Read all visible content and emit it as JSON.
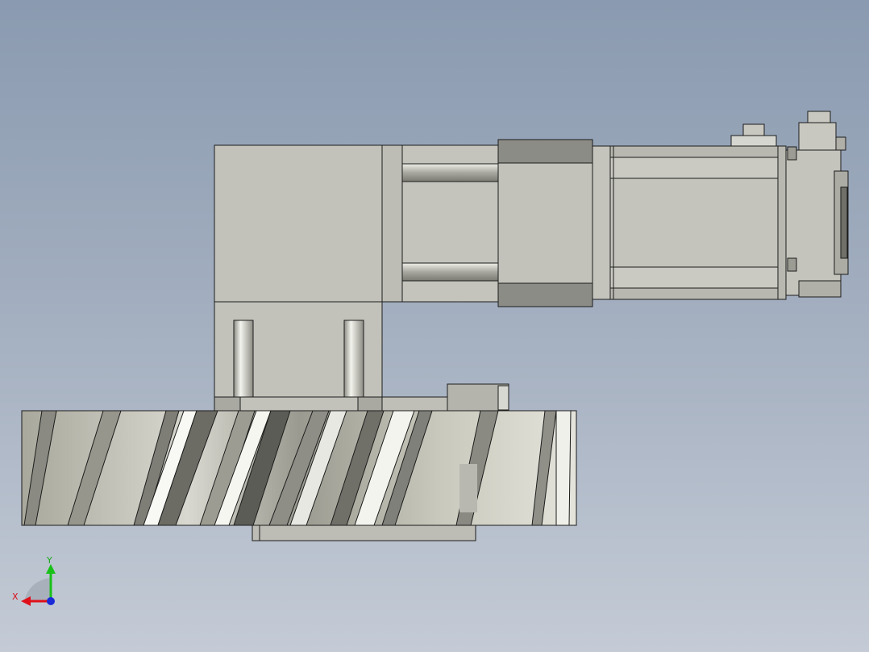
{
  "viewport": {
    "background_top": "#8a9ab0",
    "background_bottom": "#c4cbd6"
  },
  "triad": {
    "x_label": "X",
    "y_label": "Y",
    "x_color": "#e0101a",
    "y_color": "#18c018",
    "z_color": "#1a2ad8"
  },
  "model": {
    "body_color": "#c2c2ba",
    "edge_color": "#1c1c1c"
  }
}
